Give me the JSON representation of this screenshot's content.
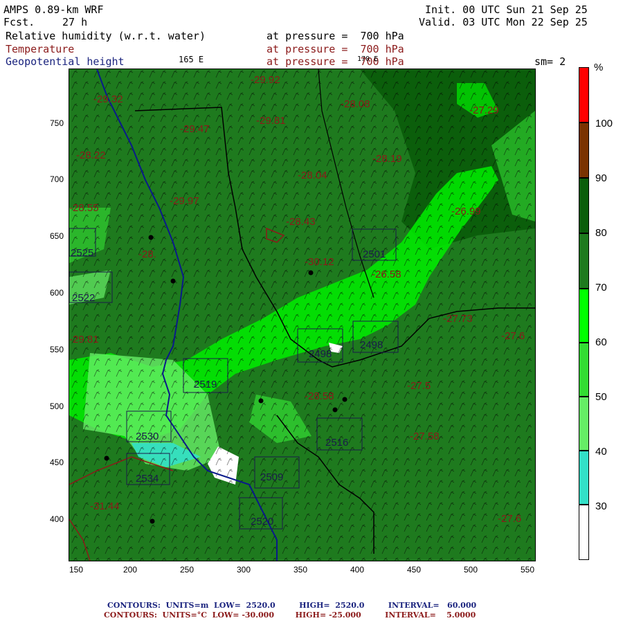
{
  "header": {
    "model": "AMPS 0.89-km WRF",
    "fcst_label": "Fcst.",
    "fcst_value": "27 h",
    "init": "Init. 00 UTC Sun 21 Sep 25",
    "valid": "Valid. 03 UTC Mon 22 Sep 25",
    "field1": "Relative humidity (w.r.t. water)",
    "field1_level": "at pressure =  700 hPa",
    "field2": "Temperature",
    "field2_level": "at pressure =  700 hPa",
    "field3": "Geopotential height",
    "field3_level": "at pressure =  700 hPa",
    "lon_label_1": "165 E",
    "lon_label_2": "170 E",
    "smoothing": "sm= 2"
  },
  "axes": {
    "x_ticks": [
      "150",
      "200",
      "250",
      "300",
      "350",
      "400",
      "450",
      "500",
      "550"
    ],
    "y_ticks": [
      "750",
      "700",
      "650",
      "600",
      "550",
      "500",
      "450",
      "400"
    ]
  },
  "colorbar": {
    "unit": "%",
    "labels": [
      "100",
      "90",
      "80",
      "70",
      "60",
      "50",
      "40",
      "30"
    ],
    "colors": [
      "#ffffff",
      "#33e0c8",
      "#66ee66",
      "#33dd33",
      "#00ff00",
      "#1e7a1e",
      "#0b5e0b",
      "#7a3300",
      "#ff0000"
    ]
  },
  "map_labels": {
    "temps": [
      "-29.92",
      "-29.32",
      "-29.47",
      "-29.81",
      "-28.08",
      "-27.29",
      "-28.22",
      "-28.19",
      "-28.04",
      "-29.97",
      "-28.43",
      "-26.99",
      "-28.55",
      "-28.",
      "-30.12",
      "-26.58",
      "-27.73",
      "-27.6",
      "-29.81",
      "-28.58",
      "-27.5",
      "-27.58",
      "-31.44",
      "-27.6"
    ],
    "heights": [
      "2525",
      "2522",
      "2501",
      "2519",
      "2498",
      "2498",
      "2530",
      "2534",
      "2509",
      "2520",
      "2516"
    ]
  },
  "footer": {
    "line1": "CONTOURS:  UNITS=m  LOW=  2520.0         HIGH=  2520.0         INTERVAL=   60.000",
    "line2": "CONTOURS:  UNITS=°C  LOW= -30.000        HIGH= -25.000         INTERVAL=    5.0000"
  }
}
